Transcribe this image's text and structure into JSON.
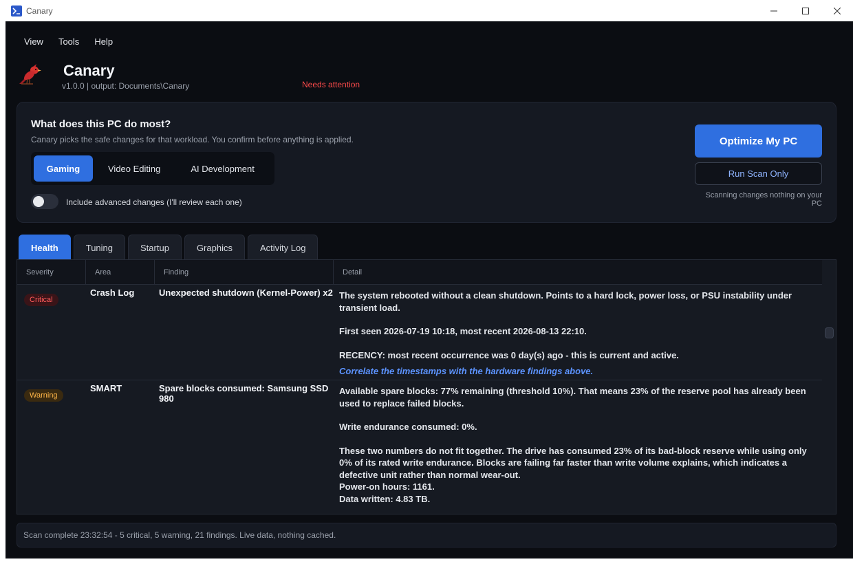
{
  "window": {
    "title": "Canary"
  },
  "menu": [
    "View",
    "Tools",
    "Help"
  ],
  "header": {
    "app_name": "Canary",
    "version_line": "v1.0.0  |  output: Documents\\Canary",
    "status": "Needs attention"
  },
  "workload": {
    "title": "What does this PC do most?",
    "description": "Canary picks the safe changes for that workload. You confirm before anything is applied.",
    "options": [
      "Gaming",
      "Video Editing",
      "AI Development"
    ],
    "selected": "Gaming",
    "advanced_toggle_label": "Include advanced changes (I'll review each one)",
    "advanced_enabled": false,
    "optimize_label": "Optimize My PC",
    "scan_label": "Run Scan Only",
    "scan_note": "Scanning changes nothing on your PC"
  },
  "tabs": [
    "Health",
    "Tuning",
    "Startup",
    "Graphics",
    "Activity Log"
  ],
  "active_tab": "Health",
  "table": {
    "columns": [
      "Severity",
      "Area",
      "Finding",
      "Detail"
    ],
    "rows": [
      {
        "severity": "Critical",
        "area": "Crash Log",
        "finding": "Unexpected shutdown (Kernel-Power) x2",
        "detail_paras": [
          "The system rebooted without a clean shutdown. Points to a hard lock, power loss, or PSU instability under transient load.",
          "First seen 2026-07-19 10:18, most recent 2026-08-13 22:10.",
          "RECENCY: most recent occurrence was 0 day(s) ago - this is current and active."
        ],
        "detail_link": "Correlate the timestamps with the hardware findings above."
      },
      {
        "severity": "Warning",
        "area": "SMART",
        "finding": "Spare blocks consumed: Samsung SSD 980",
        "detail_paras": [
          "Available spare blocks: 77% remaining (threshold 10%). That means 23% of the reserve pool has already been used to replace failed blocks.",
          "Write endurance consumed: 0%.",
          "These two numbers do not fit together. The drive has consumed 23% of its bad-block reserve while using only 0% of its rated write endurance. Blocks are failing far faster than write volume explains, which indicates a defective unit rather than normal wear-out."
        ],
        "detail_lines": [
          "Power-on hours: 1161.",
          "Data written: 4.83 TB."
        ]
      }
    ]
  },
  "status_bar": "Scan complete 23:32:54 - 5 critical, 5 warning, 21 findings. Live data, nothing cached.",
  "colors": {
    "accent": "#2f6fe0",
    "critical": "#ff5b5b",
    "warning": "#ffb648",
    "attention": "#ff4b4b",
    "link": "#5c93ff",
    "background": "#0b0d12"
  },
  "icons": [
    "powershell-icon",
    "canary-bird-logo",
    "minimize-icon",
    "maximize-icon",
    "close-icon"
  ]
}
